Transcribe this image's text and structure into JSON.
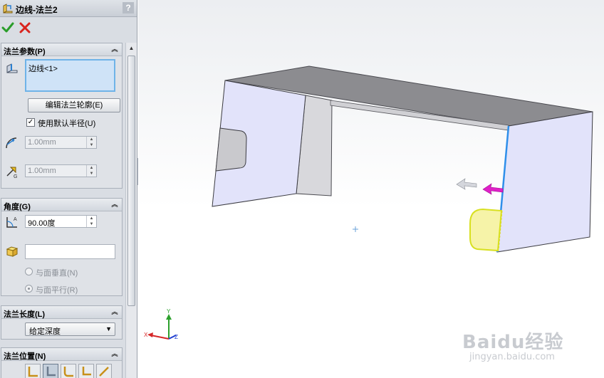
{
  "property_manager": {
    "title": "边线-法兰2",
    "help_label": "?",
    "groups": {
      "params": {
        "title": "法兰参数(P)",
        "edge_item": "边线<1>",
        "edit_profile_label": "编辑法兰轮廓(E)",
        "use_default_radius_label": "使用默认半径(U)",
        "use_default_radius_checked": true,
        "bend_radius_value": "1.00mm",
        "gap_value": "1.00mm"
      },
      "angle": {
        "title": "角度(G)",
        "angle_value": "90.00度",
        "reference_value": "",
        "perpendicular_label": "与面垂直(N)",
        "parallel_label": "与面平行(R)",
        "selected_option": "与面平行(R)"
      },
      "length": {
        "title": "法兰长度(L)",
        "end_condition": "给定深度"
      },
      "position": {
        "title": "法兰位置(N)",
        "active_index": 1
      }
    }
  },
  "viewport": {
    "triad_labels": {
      "x": "X",
      "y": "Y",
      "z": "Z"
    },
    "watermark_brand": "Baidu经验",
    "watermark_site": "jingyan.baidu.com"
  },
  "colors": {
    "accept": "#2a9d2a",
    "cancel": "#d9231d",
    "panel_face": "#e2e3fa",
    "selected_edge": "#2f8fea",
    "preview_flange": "#f6f3a8",
    "preview_outline": "#d8e020",
    "drag_arrow": "#e020c8"
  }
}
